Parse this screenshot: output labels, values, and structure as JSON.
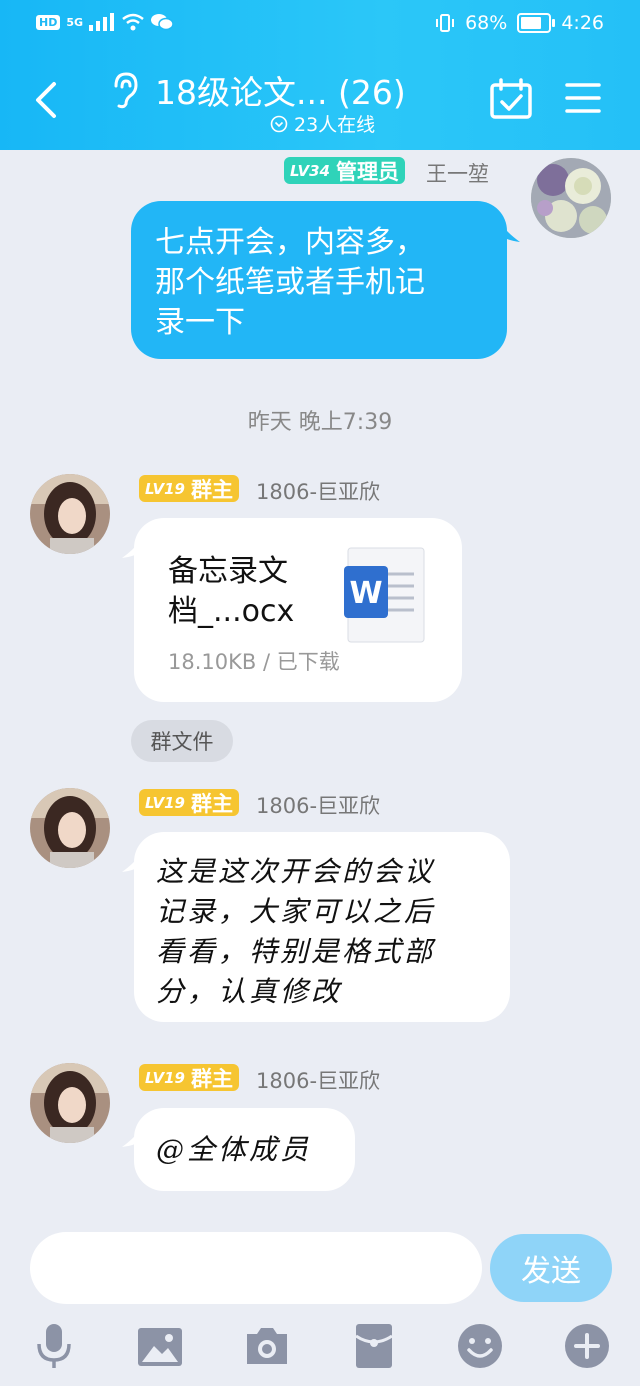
{
  "status_bar": {
    "signal_label": "5G",
    "battery": "68%",
    "time": "4:26"
  },
  "header": {
    "title": "18级论文... (26)",
    "online": "23人在线"
  },
  "messages": [
    {
      "badge_level": "LV34",
      "badge_role": "管理员",
      "sender": "王一堃",
      "lines": [
        "七点开会，内容多，",
        "那个纸笔或者手机记",
        "录一下"
      ]
    },
    {
      "time": "昨天 晚上7:39"
    },
    {
      "badge_level": "LV19",
      "badge_role": "群主",
      "sender": "1806-巨亚欣",
      "file_name_1": "备忘录文",
      "file_name_2": "档_...ocx",
      "file_meta": "18.10KB / 已下载",
      "file_icon_letter": "W"
    },
    {
      "tag": "群文件"
    },
    {
      "badge_level": "LV19",
      "badge_role": "群主",
      "sender": "1806-巨亚欣",
      "lines": [
        "这是这次开会的会议",
        "记录，大家可以之后",
        "看看，特别是格式部",
        "分，认真修改"
      ]
    },
    {
      "badge_level": "LV19",
      "badge_role": "群主",
      "sender": "1806-巨亚欣",
      "text": "@全体成员"
    }
  ],
  "input": {
    "send_label": "发送"
  },
  "colors": {
    "header": "#1fb9f5",
    "my_bubble": "#22b6f6",
    "admin_badge": "#2fd3b9",
    "owner_badge": "#f6c531",
    "send": "#8fd4f8"
  },
  "toolbar_icons": [
    "microphone-icon",
    "image-icon",
    "camera-icon",
    "red-packet-icon",
    "emoji-icon",
    "plus-icon"
  ]
}
